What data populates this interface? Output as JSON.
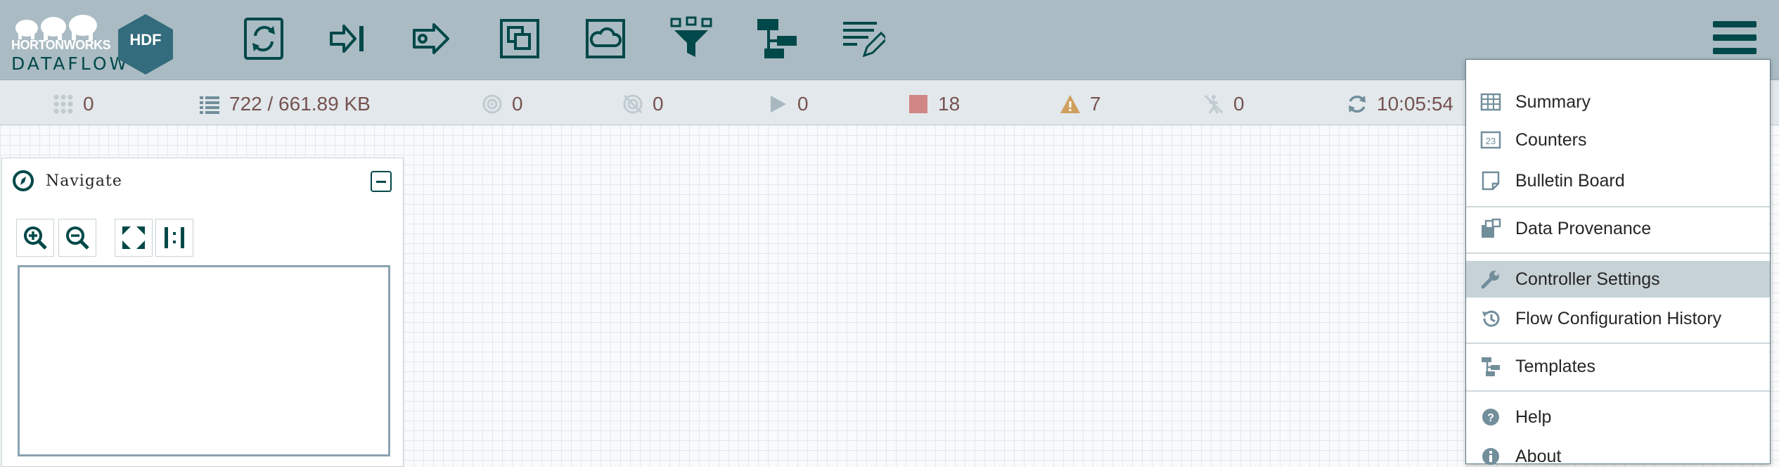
{
  "logo": {
    "brand": "HORTONWORKS",
    "product": "DATAFLOW",
    "badge": "HDF"
  },
  "toolbar": {
    "tools": [
      {
        "icon": "processor-icon"
      },
      {
        "icon": "input-port-icon"
      },
      {
        "icon": "output-port-icon"
      },
      {
        "icon": "process-group-icon"
      },
      {
        "icon": "remote-process-group-icon"
      },
      {
        "icon": "funnel-icon"
      },
      {
        "icon": "template-icon"
      },
      {
        "icon": "label-icon"
      }
    ]
  },
  "status": {
    "active_threads": "0",
    "queued": "722 / 661.89 KB",
    "transmitting": "0",
    "not_transmitting": "0",
    "running": "0",
    "stopped": "18",
    "invalid": "7",
    "disabled": "0",
    "refreshed": "10:05:54"
  },
  "navigate": {
    "title": "Navigate"
  },
  "menu": {
    "items": [
      {
        "label": "Summary",
        "icon": "summary-table-icon"
      },
      {
        "label": "Counters",
        "icon": "counters-icon"
      },
      {
        "label": "Bulletin Board",
        "icon": "bulletin-board-icon"
      },
      {
        "label": "Data Provenance",
        "icon": "provenance-icon"
      },
      {
        "label": "Controller Settings",
        "icon": "wrench-icon"
      },
      {
        "label": "Flow Configuration History",
        "icon": "history-icon"
      },
      {
        "label": "Templates",
        "icon": "templates-icon"
      },
      {
        "label": "Help",
        "icon": "help-icon"
      },
      {
        "label": "About",
        "icon": "info-icon"
      }
    ]
  },
  "colors": {
    "header": "#aabbc3",
    "accent": "#004849",
    "status_text": "#775351",
    "warning": "#cf9f5d",
    "stopped": "#d18686"
  }
}
